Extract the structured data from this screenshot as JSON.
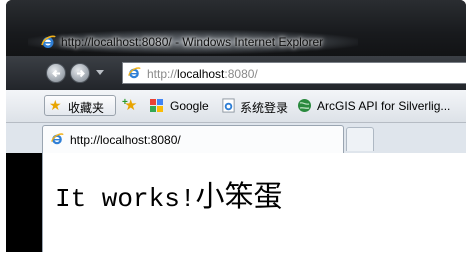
{
  "window": {
    "title": "http://localhost:8080/ - Windows Internet Explorer"
  },
  "navigation": {
    "back_icon": "back-arrow-icon",
    "forward_icon": "forward-arrow-icon",
    "address": {
      "prefix": "http://",
      "host": "localhost",
      "suffix": ":8080/"
    }
  },
  "favorites_bar": {
    "favorites_label": "收藏夹",
    "items": [
      {
        "label": "Google",
        "icon": "google-icon"
      },
      {
        "label": "系统登录",
        "icon": "ie-page-icon"
      },
      {
        "label": "ArcGIS API for Silverlig...",
        "icon": "globe-icon"
      }
    ]
  },
  "tab": {
    "label": "http://localhost:8080/"
  },
  "page": {
    "heading_latin": "It works!",
    "heading_cjk": "小笨蛋"
  }
}
